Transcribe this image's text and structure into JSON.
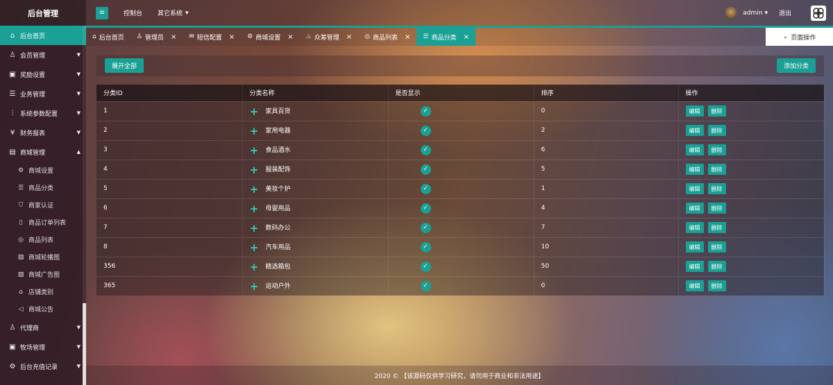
{
  "header": {
    "brand": "后台管理",
    "toggle_icon": "≡",
    "console_label": "控制台",
    "other_systems_label": "其它系统",
    "user_name": "admin",
    "logout_label": "退出"
  },
  "sidebar": {
    "items": [
      {
        "label": "后台首页",
        "icon": "home-icon",
        "active": true
      },
      {
        "label": "会员管理",
        "icon": "user-icon"
      },
      {
        "label": "奖励设置",
        "icon": "gift-icon"
      },
      {
        "label": "业务管理",
        "icon": "list-icon"
      },
      {
        "label": "系统参数配置",
        "icon": "sliders-icon"
      },
      {
        "label": "财务报表",
        "icon": "money-icon"
      },
      {
        "label": "商城管理",
        "icon": "shop-icon"
      }
    ],
    "sub_items": [
      {
        "label": "商城设置",
        "icon": "gear-icon"
      },
      {
        "label": "商品分类",
        "icon": "list-icon"
      },
      {
        "label": "商家认证",
        "icon": "shield-icon"
      },
      {
        "label": "商品订单列表",
        "icon": "document-icon"
      },
      {
        "label": "商品列表",
        "icon": "circle-list-icon"
      },
      {
        "label": "商城轮播图",
        "icon": "image-icon"
      },
      {
        "label": "商城广告图",
        "icon": "picture-icon"
      },
      {
        "label": "店铺类别",
        "icon": "store-icon"
      },
      {
        "label": "商城公告",
        "icon": "speaker-icon"
      }
    ],
    "bottom_items": [
      {
        "label": "代理商",
        "icon": "user-icon"
      },
      {
        "label": "牧场管理",
        "icon": "barn-icon"
      },
      {
        "label": "后台充值记录",
        "icon": "gear-icon"
      }
    ]
  },
  "tabs": [
    {
      "label": "后台首页",
      "icon": "home-icon",
      "closable": false
    },
    {
      "label": "管理员",
      "icon": "user-icon",
      "closable": true
    },
    {
      "label": "短信配置",
      "icon": "mail-icon",
      "closable": true
    },
    {
      "label": "商城设置",
      "icon": "gear-icon",
      "closable": true
    },
    {
      "label": "众筹管理",
      "icon": "fire-icon",
      "closable": true
    },
    {
      "label": "商品列表",
      "icon": "circle-list-icon",
      "closable": true
    },
    {
      "label": "商品分类",
      "icon": "list-icon",
      "closable": true,
      "active": true
    }
  ],
  "page_ops_label": "页面操作",
  "toolbar": {
    "expand_all_label": "展开全部",
    "add_category_label": "添加分类"
  },
  "table": {
    "columns": [
      "分类ID",
      "分类名称",
      "是否显示",
      "排序",
      "操作"
    ],
    "rows": [
      {
        "id": "1",
        "name": "家具百货",
        "sort": "0"
      },
      {
        "id": "2",
        "name": "家用电器",
        "sort": "2"
      },
      {
        "id": "3",
        "name": "食品酒水",
        "sort": "6"
      },
      {
        "id": "4",
        "name": "服装配饰",
        "sort": "5"
      },
      {
        "id": "5",
        "name": "美妆个护",
        "sort": "1"
      },
      {
        "id": "6",
        "name": "母婴用品",
        "sort": "4"
      },
      {
        "id": "7",
        "name": "数码办公",
        "sort": "7"
      },
      {
        "id": "8",
        "name": "汽车用品",
        "sort": "10"
      },
      {
        "id": "356",
        "name": "精选箱包",
        "sort": "50"
      },
      {
        "id": "365",
        "name": "运动户外",
        "sort": "0"
      }
    ],
    "edit_label": "编辑",
    "delete_label": "删除"
  },
  "footer": {
    "text": "2020 © 【该源码仅供学习研究，请勿用于商业和非法用途】"
  },
  "colors": {
    "accent": "#1aa094"
  }
}
